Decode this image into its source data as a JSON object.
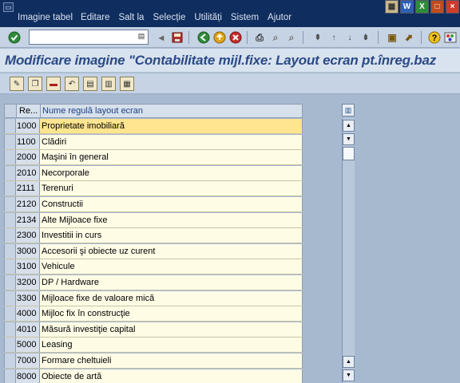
{
  "menubar": {
    "items": [
      "Imagine tabel",
      "Editare",
      "Salt la",
      "Selecție",
      "Utilități",
      "Sistem",
      "Ajutor"
    ]
  },
  "window_controls": {
    "icons": [
      "window-icon",
      "word-icon",
      "excel-icon",
      "restore-icon",
      "close-icon"
    ],
    "colors": [
      "#c9b98a",
      "#2d5fb8",
      "#2f8a3a",
      "#c04c1e",
      "#d03a2a"
    ]
  },
  "command_field": {
    "value": "",
    "placeholder": ""
  },
  "toolbar": {
    "icons": [
      "enter-icon",
      "back-arrow-icon",
      "save-icon",
      "back-icon",
      "exit-icon",
      "cancel-icon",
      "print-icon",
      "find-icon",
      "find-next-icon",
      "first-page-icon",
      "previous-page-icon",
      "next-page-icon",
      "last-page-icon",
      "create-session-icon",
      "shortcut-icon",
      "help-icon",
      "customize-layout-icon"
    ]
  },
  "title": "Modificare imagine \"Contabilitate mijl.fixe: Layout ecran pt.înreg.baz",
  "app_toolbar": {
    "icons": [
      "display-change-icon",
      "copy-icon",
      "delete-icon",
      "undo-icon",
      "select-all-icon",
      "deselect-all-icon",
      "select-block-icon"
    ]
  },
  "table": {
    "columns": [
      "Re...",
      "Nume regulă layout ecran"
    ],
    "rows": [
      {
        "code": "1000",
        "name": "Proprietate imobiliară"
      },
      {
        "code": "1100",
        "name": "Clădiri"
      },
      {
        "code": "2000",
        "name": "Maşini în general"
      },
      {
        "code": "2010",
        "name": "Necorporale"
      },
      {
        "code": "2111",
        "name": "Terenuri"
      },
      {
        "code": "2120",
        "name": "Constructii"
      },
      {
        "code": "2134",
        "name": "Alte Mijloace fixe"
      },
      {
        "code": "2300",
        "name": "Investitii in curs"
      },
      {
        "code": "3000",
        "name": "Accesorii şi obiecte uz curent"
      },
      {
        "code": "3100",
        "name": "Vehicule"
      },
      {
        "code": "3200",
        "name": "DP / Hardware"
      },
      {
        "code": "3300",
        "name": "Mijloace fixe de valoare mică"
      },
      {
        "code": "4000",
        "name": "Mijloc  fix în construcţie"
      },
      {
        "code": "4010",
        "name": "Măsură investiţie capital"
      },
      {
        "code": "5000",
        "name": "Leasing"
      },
      {
        "code": "7000",
        "name": "Formare cheltuieli"
      },
      {
        "code": "8000",
        "name": "Obiecte de artă"
      }
    ]
  },
  "colors": {
    "menubar": "#0f2d5e",
    "title_text": "#2b4a86",
    "row_bg": "#fffce6",
    "row_active": "#ffe58f",
    "background": "#a7b9cf"
  }
}
